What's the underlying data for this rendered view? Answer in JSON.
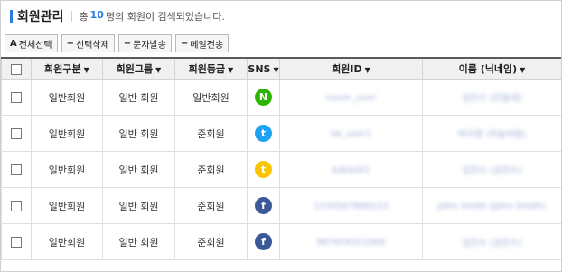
{
  "header": {
    "title": "회원관리",
    "summary_prefix": "총",
    "count": "10",
    "summary_suffix": "명의 회원이 검색되었습니다."
  },
  "toolbar": {
    "buttons": [
      {
        "icon": "A",
        "label": "전체선택"
      },
      {
        "icon": "−",
        "label": "선택삭제"
      },
      {
        "icon": "−",
        "label": "문자발송"
      },
      {
        "icon": "−",
        "label": "메일전송"
      }
    ]
  },
  "table": {
    "headers": [
      "회원구분",
      "회원그룹",
      "회원등급",
      "SNS",
      "회원ID",
      "이름 (닉네임)"
    ],
    "sort_arrow": "▼",
    "rows": [
      {
        "type": "일반회원",
        "group": "일반 회원",
        "grade": "일반회원",
        "sns": {
          "name": "naver-icon",
          "glyph": "N",
          "color": "#2db400"
        },
        "id": "naver_user",
        "name": "김민수 (민들레)"
      },
      {
        "type": "일반회원",
        "group": "일반 회원",
        "grade": "준회원",
        "sns": {
          "name": "twitter-icon",
          "glyph": "t",
          "color": "#1da1f2"
        },
        "id": "tw_user1",
        "name": "박지영 (하늘바람)"
      },
      {
        "type": "일반회원",
        "group": "일반 회원",
        "grade": "준회원",
        "sns": {
          "name": "kakao-icon",
          "glyph": "t",
          "color": "#f9c400"
        },
        "id": "kakao01",
        "name": "김민수 (김민수)"
      },
      {
        "type": "일반회원",
        "group": "일반 회원",
        "grade": "준회원",
        "sns": {
          "name": "facebook-icon",
          "glyph": "f",
          "color": "#3b5998"
        },
        "id": "1234567890123",
        "name": "John Smith (John Smith)"
      },
      {
        "type": "일반회원",
        "group": "일반 회원",
        "grade": "준회원",
        "sns": {
          "name": "facebook-icon",
          "glyph": "f",
          "color": "#3b5998"
        },
        "id": "987654321000",
        "name": "김민수 (김민수)"
      }
    ]
  }
}
